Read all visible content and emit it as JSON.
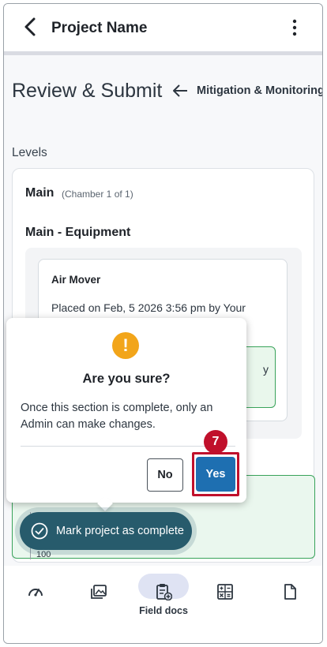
{
  "app_bar": {
    "title": "Project Name",
    "back_icon": "chevron-left-icon",
    "menu_icon": "kebab-menu-icon"
  },
  "page": {
    "heading": "Review & Submit",
    "back_link": "Mitigation & Monitoring",
    "levels_label": "Levels"
  },
  "level_card": {
    "name": "Main",
    "chamber": "(Chamber 1 of 1)",
    "equipment_title": "Main - Equipment",
    "equipment": {
      "name": "Air Mover",
      "placed": "Placed on Feb, 5 2026 3:56 pm by Your",
      "partial_text": "y"
    },
    "chart_tick": "100"
  },
  "dialog": {
    "icon": "warning-icon",
    "title": "Are you sure?",
    "body": "Once this section is complete, only an Admin can make changes.",
    "no_label": "No",
    "yes_label": "Yes"
  },
  "step_badge": "7",
  "action_pill": {
    "label": "Mark project as complete",
    "icon": "check-circle-icon"
  },
  "bottom_nav": {
    "items": [
      {
        "icon": "speedometer-icon",
        "label": ""
      },
      {
        "icon": "photos-icon",
        "label": ""
      },
      {
        "icon": "field-docs-icon",
        "label": "Field docs",
        "active": true
      },
      {
        "icon": "calculator-icon",
        "label": ""
      },
      {
        "icon": "document-icon",
        "label": ""
      }
    ]
  },
  "colors": {
    "primary": "#1e6fb1",
    "pill": "#275b6c",
    "warning": "#f2a51a",
    "highlight": "#c0102b",
    "success_border": "#39a35a"
  }
}
